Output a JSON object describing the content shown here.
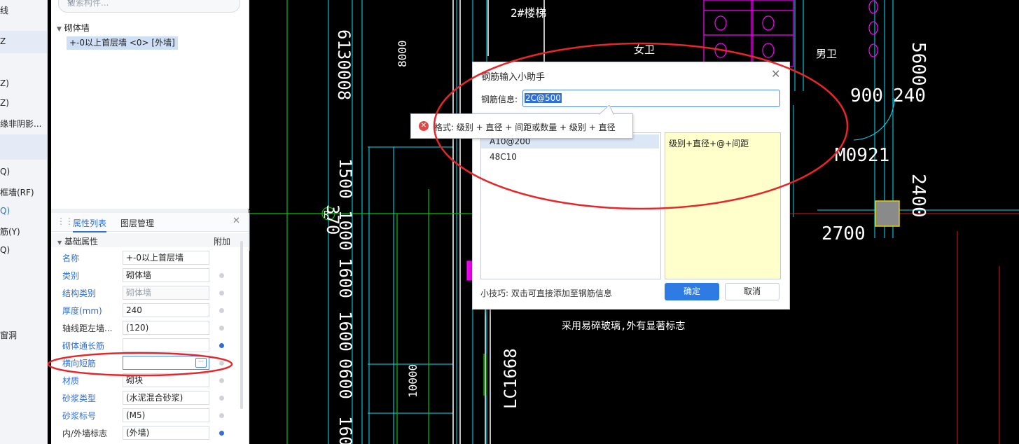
{
  "left_strip": {
    "items": [
      "线",
      "Z",
      "Z)",
      "Z)",
      "缘非阴影...",
      "Q)",
      "框墙(RF)",
      "Q)",
      "筋(Y)",
      "Q)",
      "窗洞"
    ]
  },
  "component_panel": {
    "search_placeholder": "搜索构件...",
    "tree_group": "砌体墙",
    "tree_item": "+-0以上首层墙 <0> [外墙]"
  },
  "property_panel": {
    "tab_properties": "属性列表",
    "tab_layers": "图层管理",
    "section": "基础属性",
    "column_extra": "附加",
    "rows": [
      {
        "label": "名称",
        "value": "+-0以上首层墙"
      },
      {
        "label": "类别",
        "value": "砌体墙"
      },
      {
        "label": "结构类别",
        "value": "砌体墙"
      },
      {
        "label": "厚度(mm)",
        "value": "240"
      },
      {
        "label": "轴线距左墙...",
        "value": "(120)"
      },
      {
        "label": "砌体通长筋",
        "value": ""
      },
      {
        "label": "横向短筋",
        "value": ""
      },
      {
        "label": "材质",
        "value": "砌块"
      },
      {
        "label": "砂浆类型",
        "value": "(水泥混合砂浆)"
      },
      {
        "label": "砂浆标号",
        "value": "(M5)"
      },
      {
        "label": "内/外墙标志",
        "value": "(外墙)"
      }
    ]
  },
  "cad": {
    "labels": [
      "2#楼梯",
      "女卫",
      "男卫",
      "5600",
      "900",
      "240",
      "M0921",
      "2400",
      "2700",
      "8000",
      "6130008",
      "1500",
      "370",
      "1000",
      "1600",
      "1600",
      "10000",
      "LC1668",
      "采用易碎玻璃,外有显著标志",
      "R",
      "0600",
      "160"
    ]
  },
  "dialog": {
    "title": "钢筋输入小助手",
    "info_label": "钢筋信息:",
    "info_value": "2C@500",
    "list": [
      "A10@200",
      "48C10"
    ],
    "hint": "级别+直径+@+间距",
    "tip": "小技巧: 双击可直接添加至钢筋信息",
    "ok": "确定",
    "cancel": "取消"
  },
  "tooltip": {
    "text": "格式: 级别 + 直径 + 间距或数量 + 级别 + 直径"
  },
  "colors": {
    "accent": "#2f7be4",
    "annotation": "#e8262a",
    "cad_bg": "#000000",
    "cad_cyan": "#00e5ff",
    "cad_magenta": "#ff00ff",
    "cad_green": "#00c800"
  }
}
